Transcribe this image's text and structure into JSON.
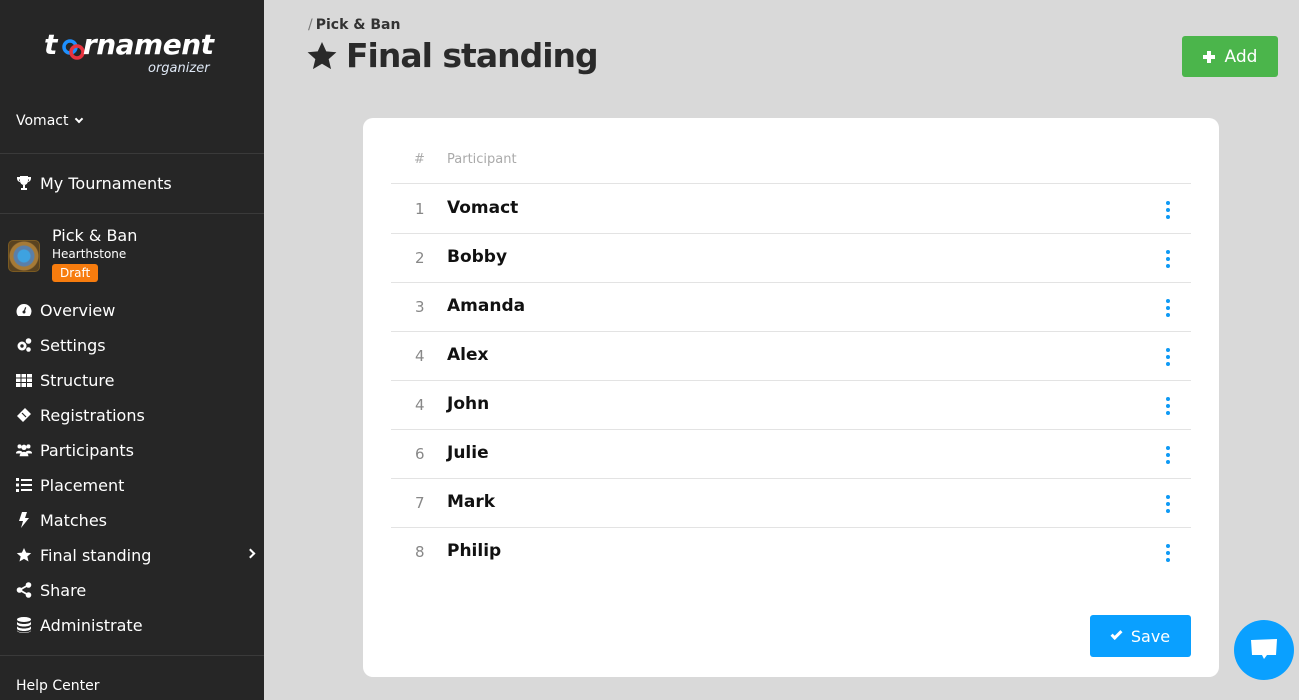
{
  "brand": {
    "logo_main": "tournament",
    "logo_sub": "organizer"
  },
  "user": {
    "name": "Vomact"
  },
  "sidebar": {
    "my_tournaments": "My Tournaments",
    "tournament": {
      "name": "Pick & Ban",
      "game": "Hearthstone",
      "status": "Draft"
    },
    "items": [
      {
        "label": "Overview",
        "icon": "dashboard-icon"
      },
      {
        "label": "Settings",
        "icon": "gears-icon"
      },
      {
        "label": "Structure",
        "icon": "grid-icon"
      },
      {
        "label": "Registrations",
        "icon": "ticket-icon"
      },
      {
        "label": "Participants",
        "icon": "users-icon"
      },
      {
        "label": "Placement",
        "icon": "ordered-list-icon"
      },
      {
        "label": "Matches",
        "icon": "bolt-icon"
      },
      {
        "label": "Final standing",
        "icon": "star-icon",
        "active": true
      },
      {
        "label": "Share",
        "icon": "share-icon"
      },
      {
        "label": "Administrate",
        "icon": "database-icon"
      }
    ],
    "help_center": "Help Center"
  },
  "header": {
    "breadcrumb_sep": "/",
    "breadcrumb": "Pick & Ban",
    "title": "Final standing",
    "add_label": "Add"
  },
  "table": {
    "headers": {
      "num": "#",
      "participant": "Participant"
    },
    "rows": [
      {
        "rank": "1",
        "name": "Vomact"
      },
      {
        "rank": "2",
        "name": "Bobby"
      },
      {
        "rank": "3",
        "name": "Amanda"
      },
      {
        "rank": "4",
        "name": "Alex"
      },
      {
        "rank": "4",
        "name": "John"
      },
      {
        "rank": "6",
        "name": "Julie"
      },
      {
        "rank": "7",
        "name": "Mark"
      },
      {
        "rank": "8",
        "name": "Philip"
      }
    ]
  },
  "save_label": "Save",
  "colors": {
    "add": "#4bb54b",
    "primary": "#0aa0ff",
    "draft": "#f77c0e",
    "sidebar": "#262626"
  }
}
